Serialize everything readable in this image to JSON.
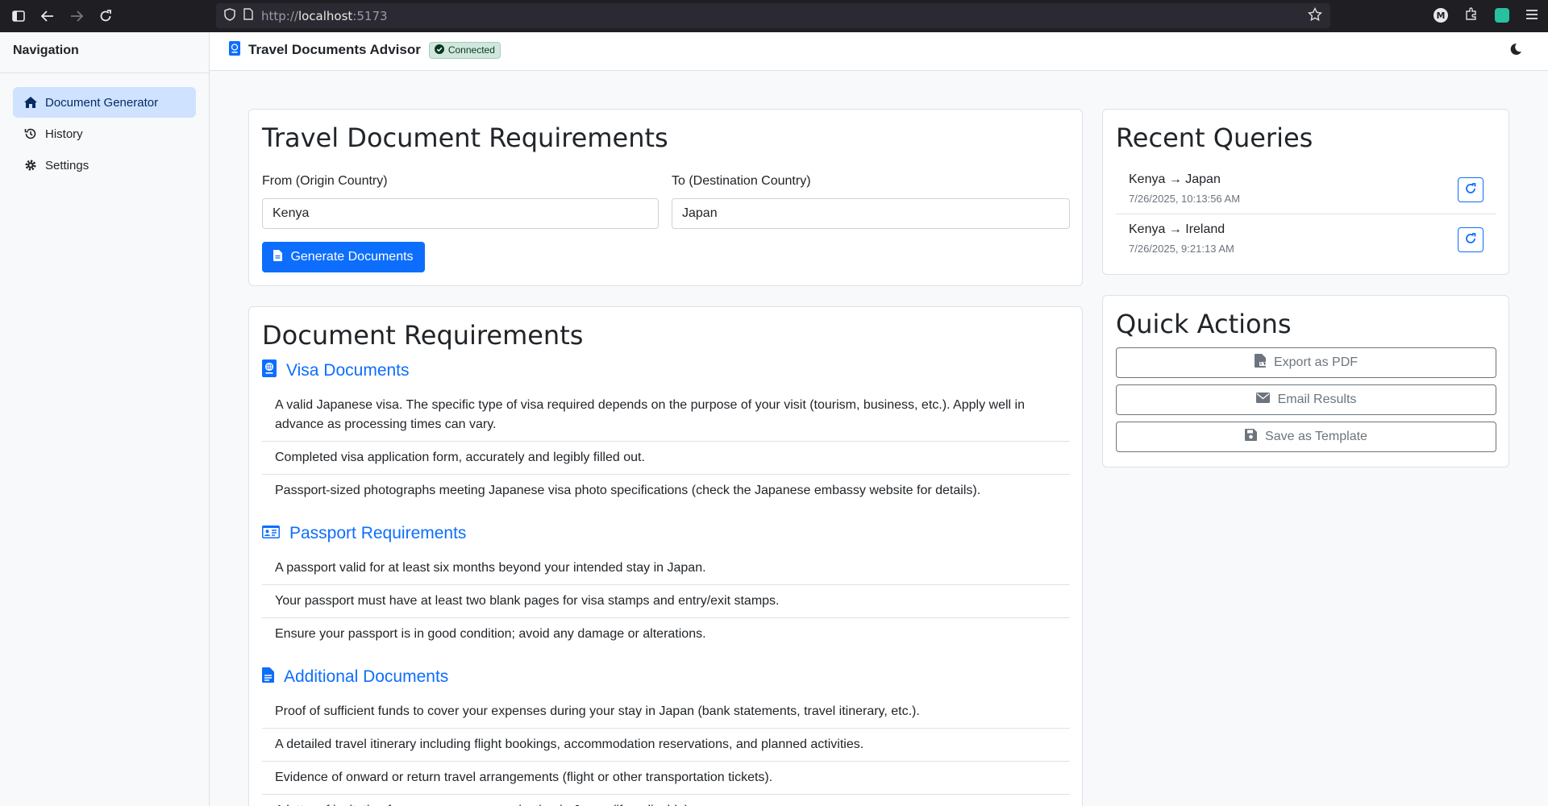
{
  "browser": {
    "url_prefix": "http://",
    "url_host": "localhost",
    "url_port": ":5173",
    "extension_m_label": "M"
  },
  "sidebar": {
    "title": "Navigation",
    "items": [
      {
        "label": "Document Generator",
        "icon": "home-icon",
        "active": true
      },
      {
        "label": "History",
        "icon": "history-icon",
        "active": false
      },
      {
        "label": "Settings",
        "icon": "gear-icon",
        "active": false
      }
    ]
  },
  "header": {
    "title": "Travel Documents Advisor",
    "status": "Connected",
    "status_color": "#198754"
  },
  "form": {
    "title": "Travel Document Requirements",
    "origin_label": "From (Origin Country)",
    "origin_value": "Kenya",
    "destination_label": "To (Destination Country)",
    "destination_value": "Japan",
    "submit_label": "Generate Documents"
  },
  "requirements": {
    "title": "Document Requirements",
    "sections": [
      {
        "title": "Visa Documents",
        "icon": "passport-icon",
        "items": [
          "A valid Japanese visa. The specific type of visa required depends on the purpose of your visit (tourism, business, etc.). Apply well in advance as processing times can vary.",
          "Completed visa application form, accurately and legibly filled out.",
          "Passport-sized photographs meeting Japanese visa photo specifications (check the Japanese embassy website for details)."
        ]
      },
      {
        "title": "Passport Requirements",
        "icon": "id-card-icon",
        "items": [
          "A passport valid for at least six months beyond your intended stay in Japan.",
          "Your passport must have at least two blank pages for visa stamps and entry/exit stamps.",
          "Ensure your passport is in good condition; avoid any damage or alterations."
        ]
      },
      {
        "title": "Additional Documents",
        "icon": "file-icon",
        "items": [
          "Proof of sufficient funds to cover your expenses during your stay in Japan (bank statements, travel itinerary, etc.).",
          "A detailed travel itinerary including flight bookings, accommodation reservations, and planned activities.",
          "Evidence of onward or return travel arrangements (flight or other transportation tickets).",
          "A letter of invitation from a person or organization in Japan (if applicable)."
        ]
      }
    ]
  },
  "recent": {
    "title": "Recent Queries",
    "items": [
      {
        "route": "Kenya → Japan",
        "time": "7/26/2025, 10:13:56 AM"
      },
      {
        "route": "Kenya → Ireland",
        "time": "7/26/2025, 9:21:13 AM"
      }
    ]
  },
  "quick_actions": {
    "title": "Quick Actions",
    "items": [
      {
        "label": "Export as PDF",
        "icon": "file-pdf-icon"
      },
      {
        "label": "Email Results",
        "icon": "envelope-icon"
      },
      {
        "label": "Save as Template",
        "icon": "save-icon"
      }
    ]
  },
  "colors": {
    "primary": "#0d6efd",
    "active_nav_bg": "#cfe2ff",
    "secondary": "#6c757d"
  }
}
